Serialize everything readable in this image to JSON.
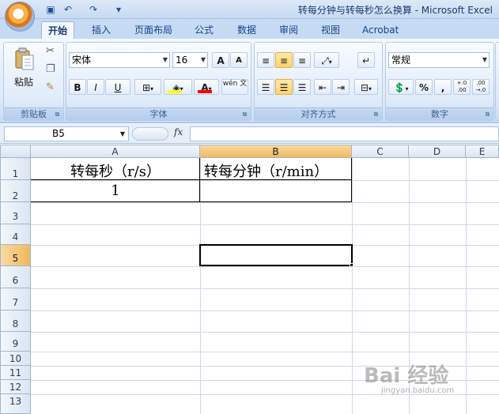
{
  "window": {
    "title": "转每分钟与转每秒怎么换算 - Microsoft Excel"
  },
  "qat": {
    "save_icon": "▣",
    "undo_icon": "↶",
    "redo_icon": "↷",
    "more_icon": "▾"
  },
  "tabs": [
    "开始",
    "插入",
    "页面布局",
    "公式",
    "数据",
    "审阅",
    "视图",
    "Acrobat"
  ],
  "ribbon": {
    "clipboard": {
      "label": "剪贴板",
      "paste_label": "粘贴"
    },
    "font": {
      "label": "字体",
      "font_name": "宋体",
      "font_size": "16",
      "grow_label": "A",
      "shrink_label": "A",
      "bold_label": "B",
      "italic_label": "I",
      "underline_label": "U",
      "font_color_label": "A",
      "phonetic_label": "wén 文"
    },
    "alignment": {
      "label": "对齐方式"
    },
    "number": {
      "label": "数字",
      "format": "常规",
      "percent_label": "%",
      "comma_label": ",",
      "inc_decimal_label": "+.0 .00",
      "dec_decimal_label": ".00 →.0"
    },
    "colors": {
      "fill": "#ffff00",
      "font": "#ff0000"
    }
  },
  "formula_bar": {
    "name_box": "B5",
    "fx_label": "fx",
    "formula": ""
  },
  "columns": [
    "A",
    "B",
    "C",
    "D",
    "E"
  ],
  "selected_column": "B",
  "rows": [
    "1",
    "2",
    "3",
    "4",
    "5",
    "6",
    "7",
    "8",
    "9",
    "10",
    "11",
    "12",
    "13"
  ],
  "selected_row": "5",
  "cells": {
    "A1": "转每秒（r/s）",
    "B1": "转每分钟（r/min）",
    "A2": "1"
  },
  "watermark": {
    "text": "Bai 经验",
    "sub": "jingyan.baidu.com"
  }
}
